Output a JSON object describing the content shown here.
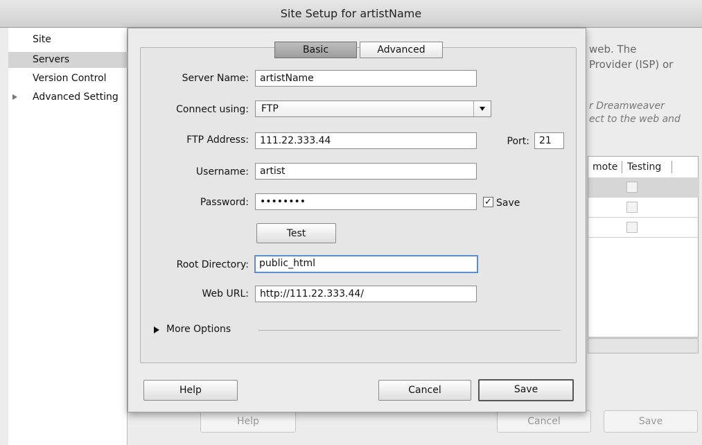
{
  "window": {
    "title": "Site Setup for artistName"
  },
  "sidebar": {
    "items": [
      {
        "label": "Site"
      },
      {
        "label": "Servers"
      },
      {
        "label": "Version Control"
      },
      {
        "label": "Advanced Setting"
      }
    ]
  },
  "background": {
    "text1": "web. The",
    "text2": "Provider (ISP) or",
    "ital1": "r Dreamweaver",
    "ital2": "ect to the web and",
    "table": {
      "col_remote": "mote",
      "col_testing": "Testing"
    },
    "buttons": {
      "help": "Help",
      "cancel": "Cancel",
      "save": "Save"
    }
  },
  "dialog": {
    "tabs": {
      "basic": "Basic",
      "advanced": "Advanced"
    },
    "labels": {
      "server_name": "Server Name:",
      "connect_using": "Connect using:",
      "ftp_address": "FTP Address:",
      "port": "Port:",
      "username": "Username:",
      "password": "Password:",
      "root_directory": "Root Directory:",
      "web_url": "Web URL:"
    },
    "values": {
      "server_name": "artistName",
      "connect_using": "FTP",
      "ftp_address": "111.22.333.44",
      "port": "21",
      "username": "artist",
      "password": "••••••••",
      "root_directory": "public_html",
      "web_url": "http://111.22.333.44/"
    },
    "save_password": {
      "label": "Save",
      "mark": "✓"
    },
    "test_button": "Test",
    "more_options": "More Options",
    "buttons": {
      "help": "Help",
      "cancel": "Cancel",
      "save": "Save"
    }
  }
}
